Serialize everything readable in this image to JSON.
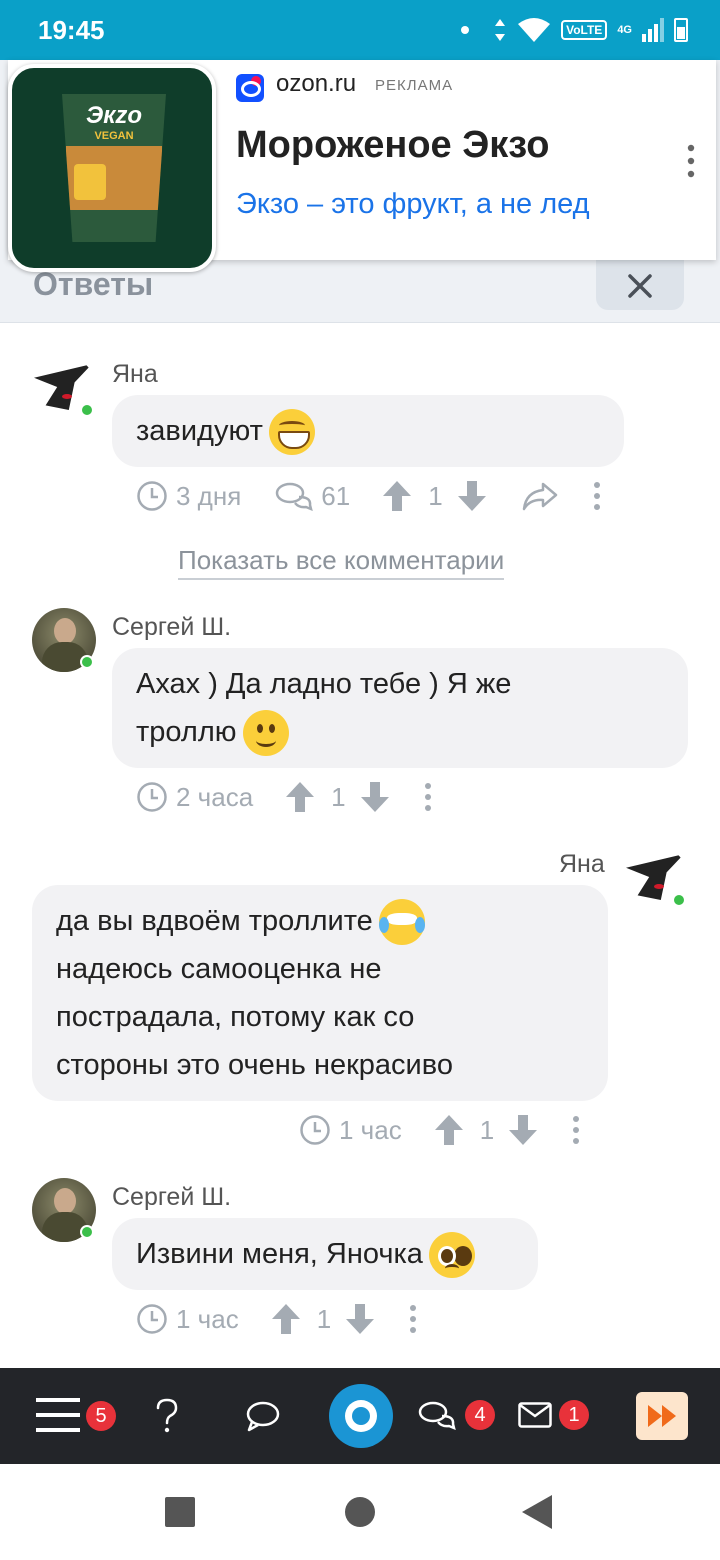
{
  "status_bar": {
    "time": "19:45",
    "volte": "VoLTE",
    "network": "4G"
  },
  "ad": {
    "source": "ozon.ru",
    "label": "РЕКЛАМА",
    "title": "Мороженое Экзо",
    "subtitle": "Экзо – это фрукт, а не лед",
    "product_brand": "Экzo",
    "product_line": "VEGAN",
    "accent_color": "#1a73e8"
  },
  "page": {
    "title": "Ответы"
  },
  "comments": [
    {
      "author": "Яна",
      "text_lines": [
        "завидуют"
      ],
      "emoji": "grinning-face-icon",
      "time": "3 дня",
      "replies": "61",
      "votes": "1",
      "align": "left"
    },
    {
      "author": "Сергей Ш.",
      "text_lines": [
        "Ахах ) Да ладно тебе ) Я же",
        "троллю"
      ],
      "emoji": "slightly-smiling-face-icon",
      "time": "2 часа",
      "votes": "1",
      "align": "left"
    },
    {
      "author": "Яна",
      "text_lines": [
        "да вы вдвоём троллите",
        "надеюсь самооценка не",
        "пострадала, потому как со",
        "стороны это очень некрасиво"
      ],
      "emoji": "tears-of-joy-face-icon",
      "time": "1 час",
      "votes": "1",
      "align": "right"
    },
    {
      "author": "Сергей Ш.",
      "text_lines": [
        "Извини меня, Яночка"
      ],
      "emoji": "pleading-face-icon",
      "time": "1 час",
      "votes": "1",
      "align": "left"
    }
  ],
  "show_all_comments": "Показать все комментарии",
  "bottom_bar": {
    "menu_badge": "5",
    "chats_badge": "4",
    "messages_badge": "1"
  },
  "colors": {
    "status_bar": "#0aa0c8",
    "app_bar": "#232529",
    "badge": "#e8323a",
    "brand": "#1b95d4",
    "online": "#3bbf4a"
  }
}
